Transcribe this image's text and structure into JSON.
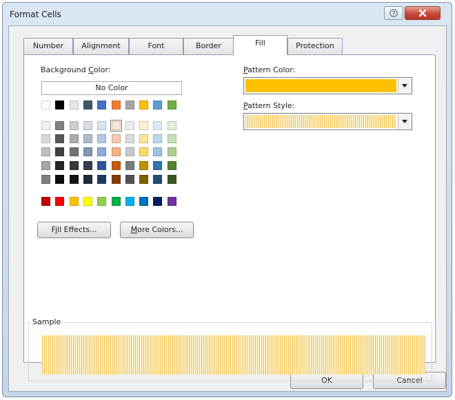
{
  "window": {
    "title": "Format Cells",
    "help_glyph": "?",
    "close_glyph": "X"
  },
  "tabs": [
    {
      "label": "Number"
    },
    {
      "label": "Alignment"
    },
    {
      "label": "Font"
    },
    {
      "label": "Border"
    },
    {
      "label": "Fill",
      "active": true
    },
    {
      "label": "Protection"
    }
  ],
  "background": {
    "label_pre": "Background ",
    "label_key": "C",
    "label_post": "olor:",
    "no_color_label": "No Color",
    "theme_row": [
      "#ffffff",
      "#000000",
      "#e7e6e6",
      "#44546a",
      "#4472c4",
      "#ed7d31",
      "#a5a5a5",
      "#ffc000",
      "#5b9bd5",
      "#70ad47"
    ],
    "tint_rows": [
      [
        "#f2f2f2",
        "#808080",
        "#d0cece",
        "#d6dce4",
        "#dae3f3",
        "#fbe5d6",
        "#ededed",
        "#fff2cc",
        "#deebf7",
        "#e2f0d9"
      ],
      [
        "#d9d9d9",
        "#595959",
        "#aeabab",
        "#adb9ca",
        "#b4c7e7",
        "#f8cbad",
        "#dbdbdb",
        "#ffe699",
        "#bdd7ee",
        "#c5e0b4"
      ],
      [
        "#bfbfbf",
        "#404040",
        "#757171",
        "#8497b0",
        "#8faadc",
        "#f4b183",
        "#c9c9c9",
        "#ffd966",
        "#9dc3e6",
        "#a9d18e"
      ],
      [
        "#a6a6a6",
        "#262626",
        "#3a3838",
        "#333f50",
        "#2f5597",
        "#c55a11",
        "#7b7b7b",
        "#bf9000",
        "#2e75b6",
        "#548235"
      ],
      [
        "#7f7f7f",
        "#0d0d0d",
        "#171616",
        "#222a35",
        "#203864",
        "#843c0c",
        "#525252",
        "#7f6000",
        "#1f4e79",
        "#385723"
      ]
    ],
    "standard_row": [
      "#c00000",
      "#ff0000",
      "#ffc000",
      "#ffff00",
      "#92d050",
      "#00b050",
      "#00b0f0",
      "#0070c0",
      "#002060",
      "#7030a0"
    ],
    "fill_effects": {
      "pre": "F",
      "key": "i",
      "post": "ll Effects..."
    },
    "more_colors": {
      "pre": "",
      "key": "M",
      "post": "ore Colors..."
    }
  },
  "pattern": {
    "color_label": {
      "pre": "",
      "key": "P",
      "post": "attern Color:"
    },
    "color_value": "#ffc000",
    "style_label": {
      "pre": "",
      "key": "P",
      "post": "attern Style:"
    },
    "style_value": "vertical-stripe"
  },
  "sample": {
    "label": "Sample"
  },
  "buttons": {
    "ok": "OK",
    "cancel": "Cancel"
  }
}
